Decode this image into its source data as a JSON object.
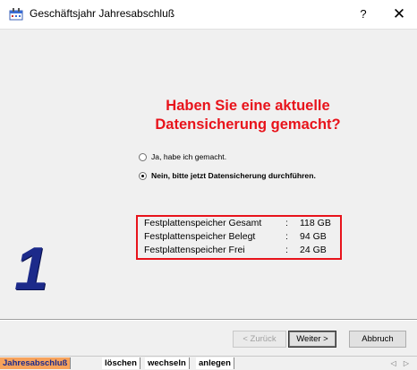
{
  "window": {
    "title": "Geschäftsjahr Jahresabschluß",
    "help_label": "?",
    "close_label": "✕"
  },
  "question": {
    "line1": "Haben Sie eine aktuelle",
    "line2": "Datensicherung gemacht?",
    "color": "#e8131b"
  },
  "options": [
    {
      "label": "Ja, habe ich gemacht.",
      "checked": false
    },
    {
      "label": "Nein, bitte jetzt Datensicherung durchführen.",
      "checked": true
    }
  ],
  "disk": [
    {
      "label": "Festplattenspeicher Gesamt",
      "sep": ":",
      "value": "118 GB"
    },
    {
      "label": "Festplattenspeicher Belegt",
      "sep": ":",
      "value": "94 GB"
    },
    {
      "label": "Festplattenspeicher Frei",
      "sep": ":",
      "value": "24 GB"
    }
  ],
  "step_number": "1",
  "buttons": {
    "back": "< Zurück",
    "next": "Weiter >",
    "cancel": "Abbruch"
  },
  "tabs": [
    {
      "label": "Jahresabschluß",
      "active": true
    },
    {
      "label": "löschen",
      "active": false
    },
    {
      "label": "wechseln",
      "active": false
    },
    {
      "label": "anlegen",
      "active": false
    }
  ],
  "tab_arrows": "◁ ▷",
  "colors": {
    "accent_red": "#e8131b",
    "step_blue": "#1c2a8a",
    "tab_orange": "#f7a25b"
  }
}
